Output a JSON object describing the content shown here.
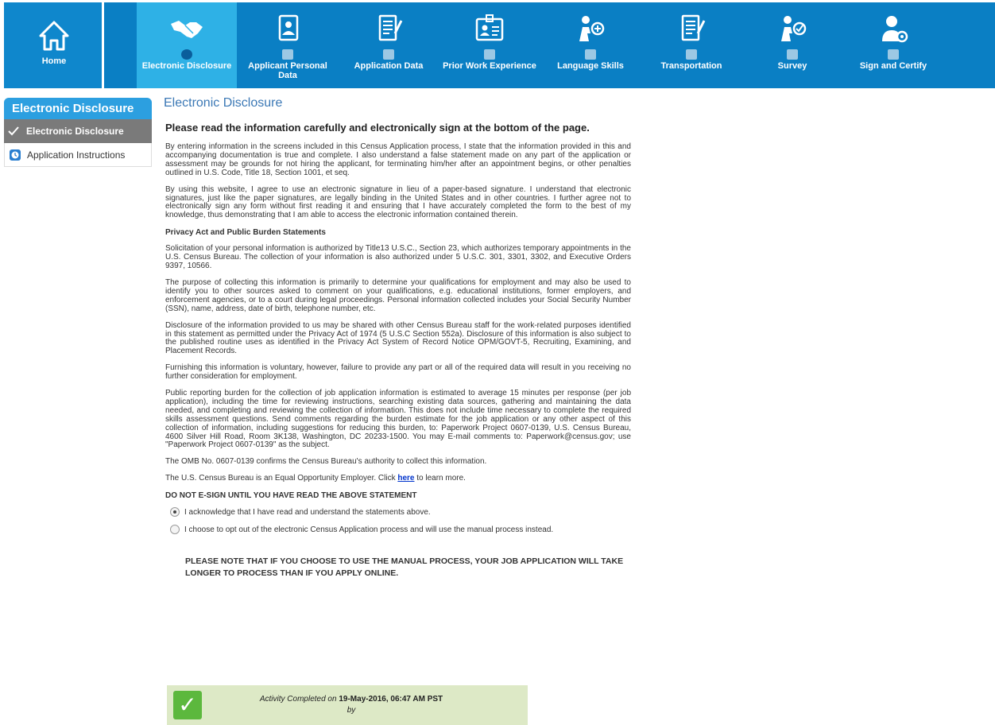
{
  "nav": {
    "home": {
      "label": "Home",
      "icon": "home-icon"
    },
    "tabs": [
      {
        "label": "Electronic Disclosure",
        "icon": "handshake-icon",
        "status_icon": "clock-icon",
        "active": true
      },
      {
        "label": "Applicant Personal Data",
        "icon": "person-document-icon",
        "status_icon": "lock-icon",
        "active": false
      },
      {
        "label": "Application Data",
        "icon": "edit-document-icon",
        "status_icon": "lock-icon",
        "active": false
      },
      {
        "label": "Prior Work Experience",
        "icon": "id-badge-icon",
        "status_icon": "lock-icon",
        "active": false
      },
      {
        "label": "Language Skills",
        "icon": "person-plus-icon",
        "status_icon": "lock-icon",
        "active": false
      },
      {
        "label": "Transportation",
        "icon": "edit-document-icon",
        "status_icon": "lock-icon",
        "active": false
      },
      {
        "label": "Survey",
        "icon": "person-check-icon",
        "status_icon": "lock-icon",
        "active": false
      },
      {
        "label": "Sign and Certify",
        "icon": "person-gear-icon",
        "status_icon": "lock-icon",
        "active": false
      }
    ]
  },
  "sidebar": {
    "title": "Electronic Disclosure",
    "items": [
      {
        "label": "Electronic Disclosure",
        "icon": "check-icon",
        "active": true
      },
      {
        "label": "Application Instructions",
        "icon": "clock-icon",
        "active": false
      }
    ]
  },
  "main": {
    "title": "Electronic Disclosure",
    "lead": "Please read the information carefully and electronically sign at the bottom of the page.",
    "p1": "By entering information in the screens included in this Census Application process, I state that the information provided in this and accompanying documentation is true and complete. I also understand a false statement made on any part of the application or assessment may be grounds for not hiring the applicant, for terminating him/her after an appointment begins, or other penalties outlined in U.S. Code, Title 18, Section 1001, et seq.",
    "p2": "By using this website, I agree to use an electronic signature in lieu of a paper-based signature. I understand that electronic signatures, just like the paper signatures, are legally binding in the United States and in other countries. I further agree not to electronically sign any form without first reading it and ensuring that I have accurately completed the form to the best of my knowledge, thus demonstrating that I am able to access the electronic information contained therein.",
    "privacy_heading": "Privacy Act and Public Burden Statements",
    "p3": "Solicitation of your personal information is authorized by Title13 U.S.C., Section 23, which authorizes temporary appointments in the U.S. Census Bureau. The collection of your information is also authorized under 5 U.S.C. 301, 3301, 3302, and Executive Orders 9397, 10566.",
    "p4": "The purpose of collecting this information is primarily to determine your qualifications for employment and may also be used to identify you to other sources asked to comment on your qualifications, e.g. educational institutions, former employers, and enforcement agencies, or to a court during legal proceedings. Personal information collected includes your Social Security Number (SSN), name, address, date of birth, telephone number, etc.",
    "p5": "Disclosure of the information provided to us may be shared with other Census Bureau staff for the work-related purposes identified in this statement as permitted under the Privacy Act of 1974 (5 U.S.C Section 552a). Disclosure of this information is also subject to the published routine uses as identified in the Privacy Act System of Record Notice OPM/GOVT-5, Recruiting, Examining, and Placement Records.",
    "p6": "Furnishing this information is voluntary, however, failure to provide any part or all of the required data will result in you receiving no further consideration for employment.",
    "p7": "Public reporting burden for the collection of job application information is estimated to average 15 minutes per response (per job application), including the time for reviewing instructions, searching existing data sources, gathering and maintaining the data needed, and completing and reviewing the collection of information. This does not include time necessary to complete the required skills assessment questions.  Send comments regarding the burden estimate for the job application or any other aspect of this collection of information, including suggestions for reducing this burden, to: Paperwork Project 0607-0139, U.S. Census Bureau, 4600 Silver Hill Road, Room 3K138, Washington, DC 20233-1500. You may E-mail comments to: Paperwork@census.gov; use \"Paperwork Project 0607-0139\" as the subject.",
    "p8": "The OMB No. 0607-0139 confirms the Census Bureau's authority to collect this information.",
    "p9_before": "The U.S. Census Bureau is an Equal Opportunity Employer.  Click ",
    "p9_link": "here",
    "p9_after": " to learn more.",
    "warning": "DO NOT E-SIGN UNTIL YOU HAVE READ THE ABOVE STATEMENT",
    "options": [
      {
        "label": "I acknowledge that I have read and understand the statements above.",
        "selected": true
      },
      {
        "label": "I choose to opt out of the electronic Census Application process and will use the manual process instead.",
        "selected": false
      }
    ],
    "note": "PLEASE NOTE THAT IF YOU CHOOSE TO USE THE MANUAL PROCESS, YOUR JOB APPLICATION WILL TAKE LONGER TO PROCESS THAN IF YOU APPLY ONLINE."
  },
  "completed": {
    "prefix": "Activity Completed on ",
    "datetime": "19-May-2016, 06:47 AM PST",
    "by": "by",
    "icon": "check-icon"
  },
  "colors": {
    "nav_bg": "#0a7fc4",
    "nav_active": "#2eb1e6",
    "sidebar_title": "#2c9fe0",
    "sidebar_active": "#7a7a7a",
    "title_blue": "#3b78b5",
    "completed_bg": "#dde9c6",
    "check_green": "#5cb83d"
  }
}
